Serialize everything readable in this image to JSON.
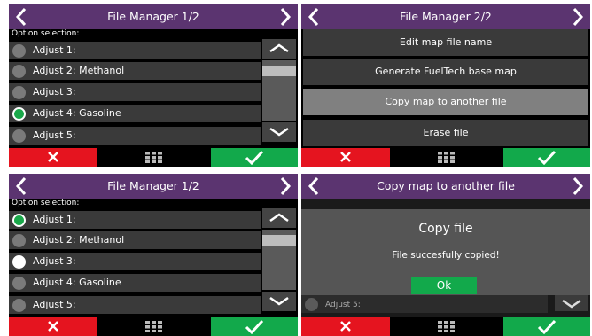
{
  "colors": {
    "title_bar": "#5b3470",
    "cancel": "#e5141f",
    "confirm": "#12a94b",
    "row": "#3a3a3a",
    "row_highlight": "#808080",
    "radio_selected": "#1aa84a"
  },
  "panels": [
    {
      "title": "File Manager 1/2",
      "option_label": "Option selection:",
      "items": [
        {
          "label": "Adjust 1:",
          "state": "off"
        },
        {
          "label": "Adjust 2: Methanol",
          "state": "off"
        },
        {
          "label": "Adjust 3:",
          "state": "off"
        },
        {
          "label": "Adjust 4: Gasoline",
          "state": "selected"
        },
        {
          "label": "Adjust 5:",
          "state": "off"
        }
      ]
    },
    {
      "title": "File Manager 2/2",
      "buttons": [
        {
          "label": "Edit map file name",
          "highlighted": false
        },
        {
          "label": "Generate FuelTech base map",
          "highlighted": false
        },
        {
          "label": "Copy map to another file",
          "highlighted": true
        },
        {
          "label": "Erase file",
          "highlighted": false
        }
      ]
    },
    {
      "title": "File Manager 1/2",
      "option_label": "Option selection:",
      "items": [
        {
          "label": "Adjust 1:",
          "state": "selected"
        },
        {
          "label": "Adjust 2: Methanol",
          "state": "off"
        },
        {
          "label": "Adjust 3:",
          "state": "target"
        },
        {
          "label": "Adjust 4: Gasoline",
          "state": "off"
        },
        {
          "label": "Adjust 5:",
          "state": "off"
        }
      ]
    },
    {
      "title": "Copy map to another file",
      "background_row": "Adjust 5:",
      "dialog": {
        "title": "Copy file",
        "message": "File succesfully copied!",
        "ok_label": "Ok"
      }
    }
  ]
}
